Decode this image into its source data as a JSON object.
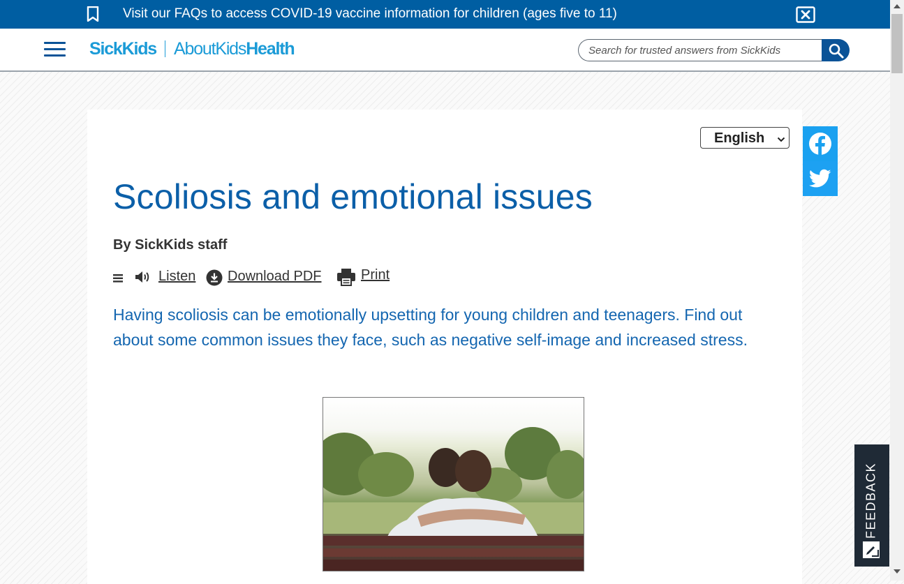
{
  "banner": {
    "message": "Visit our FAQs to access COVID-19 vaccine information for children (ages five to 11)",
    "bookmark_icon": "bookmark-icon",
    "close_icon": "close-x-icon"
  },
  "header": {
    "logo_sickkids": "SickKids",
    "logo_about": "AboutKids",
    "logo_health": "Health",
    "search_placeholder": "Search for trusted answers from SickKids",
    "search_icon": "search-icon",
    "menu_icon": "hamburger-menu-icon"
  },
  "language": {
    "selected": "English"
  },
  "social": [
    "facebook-icon",
    "twitter-icon"
  ],
  "article": {
    "title": "Scoliosis and emotional issues",
    "byline": "By SickKids staff",
    "tools": {
      "listen": "Listen",
      "download": "Download PDF",
      "print": "Print"
    },
    "lead": "Having scoliosis can be emotionally upsetting for young children and teenagers. Find out about some common issues they face, such as negative self-image and increased stress."
  },
  "feedback": {
    "label": "FEEDBACK"
  },
  "colors": {
    "brand_blue": "#005ea2",
    "title_blue": "#0b5fa8",
    "logo_cyan": "#1b9bd7",
    "feedback_bg": "#1f2a36"
  }
}
